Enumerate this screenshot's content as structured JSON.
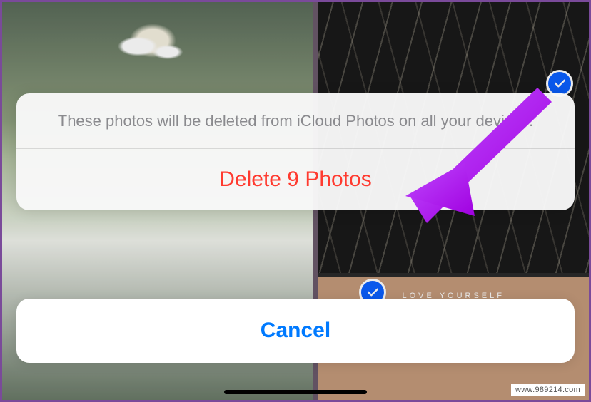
{
  "sheet": {
    "message": "These photos will be deleted from iCloud Photos on all your devices.",
    "delete_label": "Delete 9 Photos",
    "cancel_label": "Cancel"
  },
  "background": {
    "love_yourself_text": "LOVE YOURSELF"
  },
  "colors": {
    "destructive": "#ff3b30",
    "link": "#007aff",
    "selection_badge": "#0a60ff",
    "annotation_arrow": "#b400ff"
  },
  "watermark": "www.989214.com"
}
